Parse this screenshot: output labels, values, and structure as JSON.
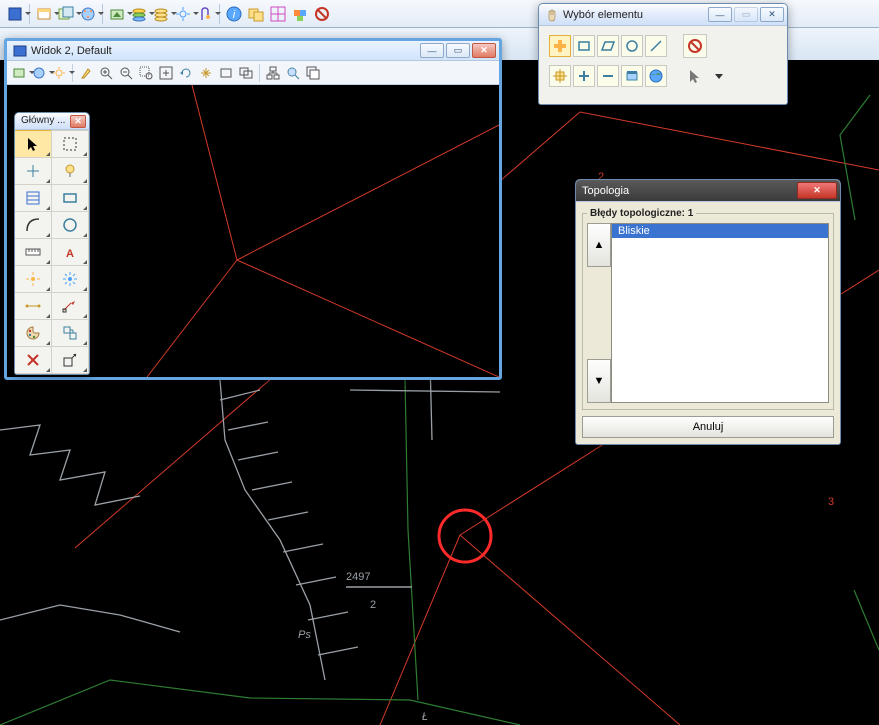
{
  "windows": {
    "widok": {
      "title": "Widok 2, Default"
    },
    "tools": {
      "title": "Główny ..."
    },
    "wybor": {
      "title": "Wybór elementu"
    },
    "topo": {
      "title": "Topologia",
      "legend": "Błędy topologiczne: 1",
      "items": [
        "Bliskie"
      ],
      "cancel": "Anuluj"
    }
  },
  "canvas_labels": {
    "n2": "2",
    "n3": "3",
    "frac_top": "2497",
    "frac_bot": "2",
    "ps": "Ps",
    "l": "Ł"
  },
  "colors": {
    "accent": "#3a74d0",
    "error_ring": "#ff2a2a",
    "draw_red": "#d43a2a",
    "draw_green": "#2e7d32",
    "draw_gray": "#9aa0a6"
  }
}
